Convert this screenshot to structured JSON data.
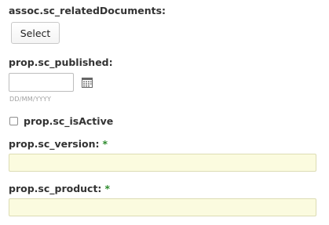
{
  "related_documents": {
    "label": "assoc.sc_relatedDocuments:",
    "button_label": "Select"
  },
  "published": {
    "label": "prop.sc_published:",
    "value": "",
    "date_format_hint": "DD/MM/YYYY",
    "icon": "calendar-icon"
  },
  "is_active": {
    "label": "prop.sc_isActive",
    "checked": false
  },
  "version": {
    "label": "prop.sc_version:",
    "required_marker": "*",
    "value": ""
  },
  "product": {
    "label": "prop.sc_product:",
    "required_marker": "*",
    "value": ""
  },
  "colors": {
    "required": "#2e8b2e",
    "required_field_bg": "#fbfbdf"
  }
}
